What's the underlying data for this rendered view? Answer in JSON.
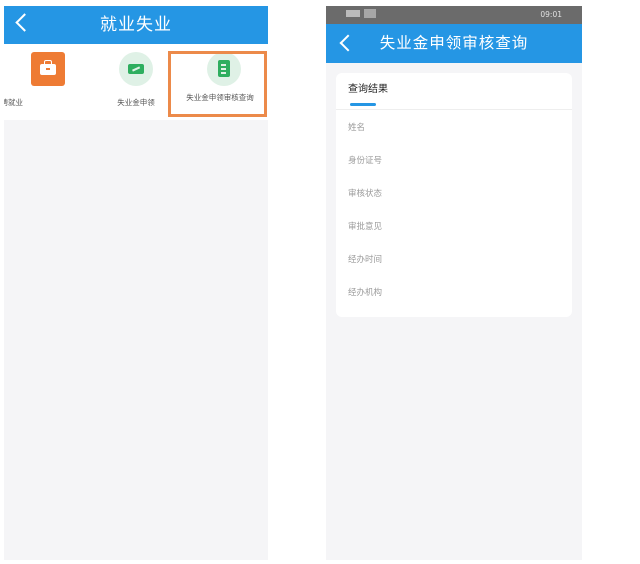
{
  "left_screen": {
    "title": "就业失业",
    "menu_items": [
      {
        "label": "招聘就业",
        "icon": "briefcase-icon"
      },
      {
        "label": "失业金申领",
        "icon": "ticket-icon"
      },
      {
        "label": "失业金申领审核查询",
        "icon": "document-icon"
      }
    ],
    "colors": {
      "header": "#2596e4",
      "highlight": "#ec8a4a",
      "orange_icon": "#ee7b34",
      "green_icon": "#2eae5f"
    }
  },
  "right_screen": {
    "status_time": "09:01",
    "title": "失业金申领审核查询",
    "tab_label": "查询结果",
    "fields": [
      "姓名",
      "身份证号",
      "审核状态",
      "审批意见",
      "经办时间",
      "经办机构"
    ]
  }
}
